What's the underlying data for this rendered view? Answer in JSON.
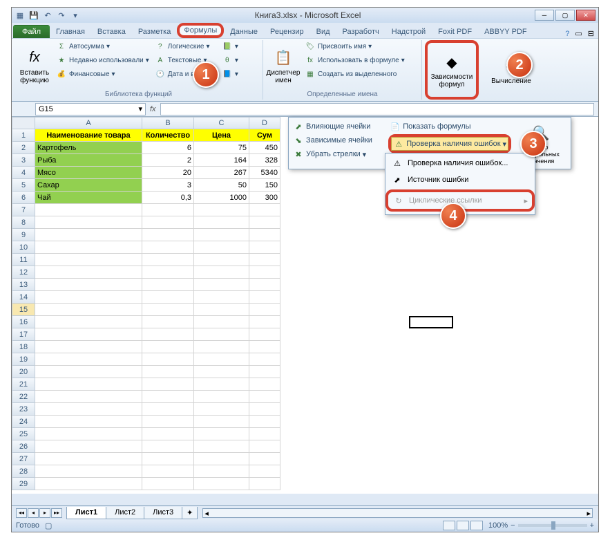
{
  "title": "Книга3.xlsx - Microsoft Excel",
  "tabs": [
    "Файл",
    "Главная",
    "Вставка",
    "Разметка",
    "Формулы",
    "Данные",
    "Рецензир",
    "Вид",
    "Разработч",
    "Надстрой",
    "Foxit PDF",
    "ABBYY PDF"
  ],
  "activeTab": 4,
  "ribbon": {
    "g1": {
      "title": "Библиотека функций",
      "big": "Вставить\nфункцию",
      "items": [
        "Автосумма",
        "Недавно использовали",
        "Финансовые",
        "Логические",
        "Текстовые",
        "Дата и время"
      ]
    },
    "g2": {
      "title": "Определенные имена",
      "big": "Диспетчер\nимен",
      "items": [
        "Присвоить имя",
        "Использовать в формуле",
        "Создать из выделенного"
      ]
    },
    "g3": {
      "big": "Зависимости\nформул"
    },
    "g4": {
      "big": "Вычисление"
    }
  },
  "namebox": "G15",
  "colWidths": {
    "A": 155,
    "B": 75,
    "C": 80,
    "D": 45
  },
  "sheet": {
    "headers": [
      "Наименование товара",
      "Количество",
      "Цена",
      "Сум"
    ],
    "rows": [
      {
        "name": "Картофель",
        "qty": "6",
        "price": "75",
        "sum": "450"
      },
      {
        "name": "Рыба",
        "qty": "2",
        "price": "164",
        "sum": "328"
      },
      {
        "name": "Мясо",
        "qty": "20",
        "price": "267",
        "sum": "5340"
      },
      {
        "name": "Сахар",
        "qty": "3",
        "price": "50",
        "sum": "150"
      },
      {
        "name": "Чай",
        "qty": "0,3",
        "price": "1000",
        "sum": "300"
      }
    ]
  },
  "dd1": {
    "left": [
      "Влияющие ячейки",
      "Зависимые ячейки",
      "Убрать стрелки"
    ],
    "right_top": "Показать формулы",
    "right_mid": "Проверка наличия ошибок",
    "right_big1": "Окно\nконтрольных\nзначения"
  },
  "dd2": {
    "items": [
      "Проверка наличия ошибок...",
      "Источник ошибки",
      "Циклические ссылки"
    ]
  },
  "sheets": [
    "Лист1",
    "Лист2",
    "Лист3"
  ],
  "status": "Готово",
  "zoom": "100%"
}
